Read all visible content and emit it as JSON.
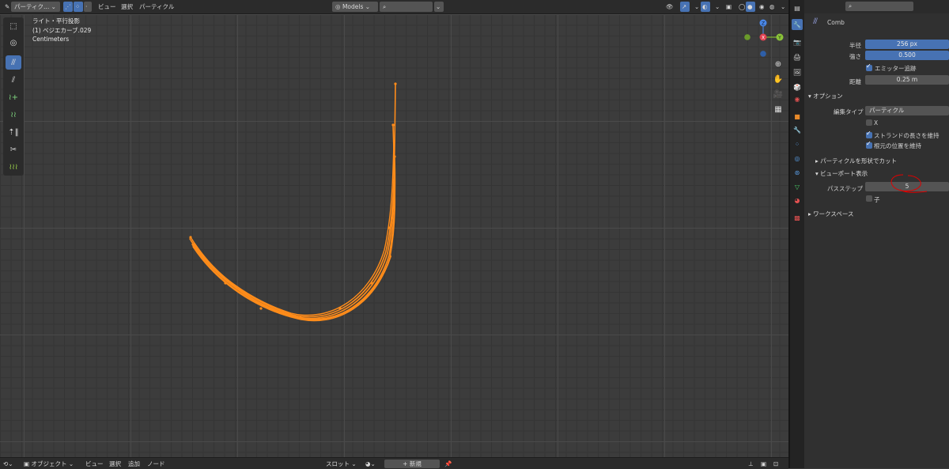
{
  "header": {
    "mode_label": "パーティク...",
    "menu": [
      "ビュー",
      "選択",
      "パーティクル"
    ],
    "orientation_label": "Models",
    "search_placeholder": ""
  },
  "viewport": {
    "overlay_lines": [
      "ライト・平行投影",
      "(1) ベジエカーブ.029",
      "Centimeters"
    ],
    "gizmo": {
      "z": "Z",
      "y": "Y",
      "x": "X"
    }
  },
  "tools": [
    {
      "icon": "select-box-icon",
      "active": false
    },
    {
      "icon": "cursor-icon",
      "active": false
    },
    {
      "icon": "comb-icon",
      "active": true
    },
    {
      "icon": "smooth-icon",
      "active": false
    },
    {
      "icon": "add-icon",
      "active": false
    },
    {
      "icon": "length-icon",
      "active": false
    },
    {
      "icon": "puff-icon",
      "active": false
    },
    {
      "icon": "cut-icon",
      "active": false
    },
    {
      "icon": "weight-icon",
      "active": false
    }
  ],
  "properties": {
    "brush_name": "Comb",
    "radius_label": "半径",
    "radius_value": "256 px",
    "strength_label": "強さ",
    "strength_value": "0.500",
    "emitter_label": "エミッター追跡",
    "distance_label": "距離",
    "distance_value": "0.25 m",
    "options_header": "オプション",
    "edit_type_label": "編集タイプ",
    "edit_type_value": "パーティクル",
    "x_label": "X",
    "preserve_length_label": "ストランドの長さを維持",
    "preserve_root_label": "根元の位置を維持",
    "cut_by_shape_label": "パーティクルを形状でカット",
    "viewport_display_header": "ビューポート表示",
    "path_steps_label": "パスステップ",
    "path_steps_value": "5",
    "children_label": "子",
    "workspace_header": "ワークスペース"
  },
  "bottom_bar": {
    "object_mode_label": "オブジェクト",
    "menu": [
      "ビュー",
      "選択",
      "追加",
      "ノード"
    ],
    "slot_label": "スロット",
    "new_label": "新規"
  },
  "colors": {
    "accent": "#4772b3",
    "hair": "#ff8c1a",
    "annotation": "#e00000"
  }
}
